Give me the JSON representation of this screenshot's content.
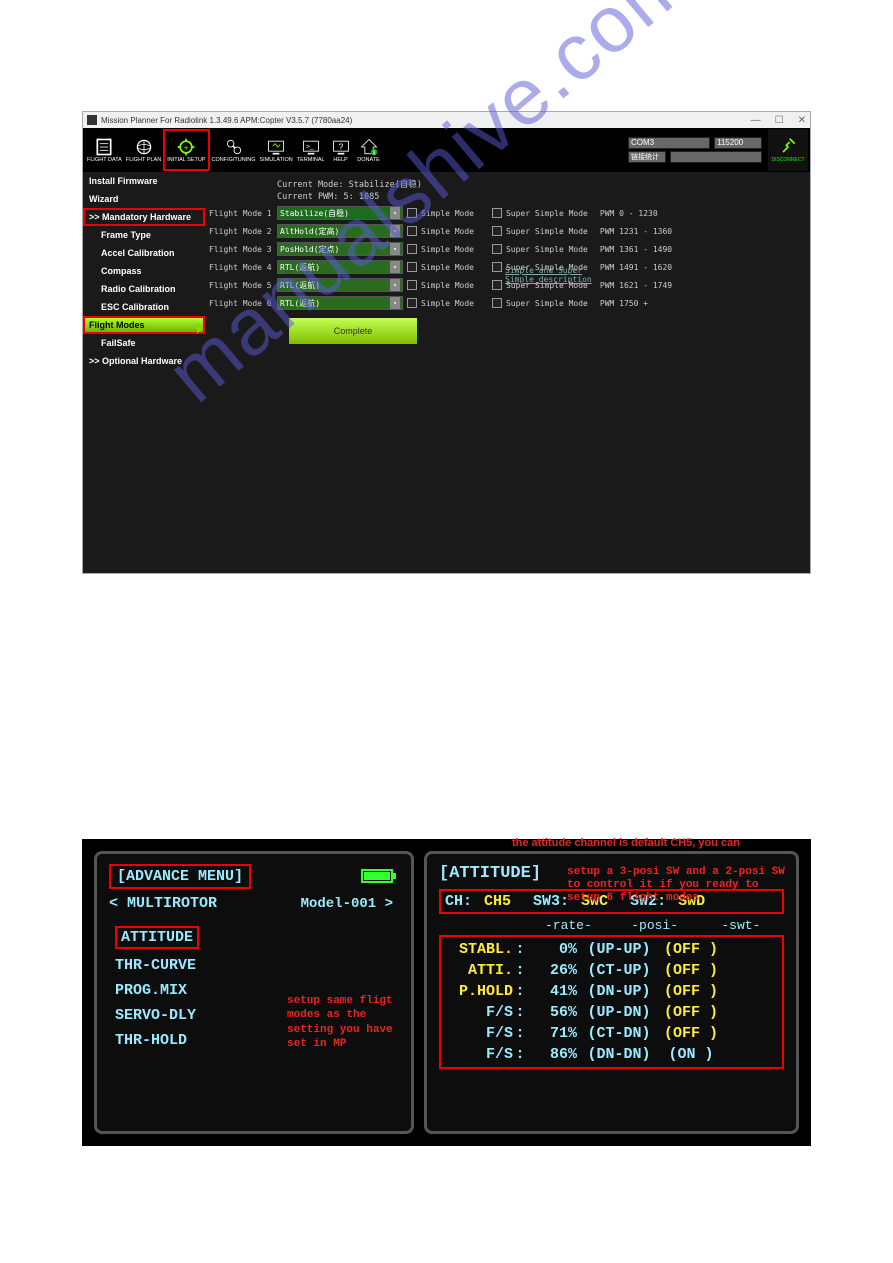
{
  "mp": {
    "title": "Mission Planner For Radiolink 1.3.49.6 APM:Copter V3.5.7 (7780aa24)",
    "toolbar": [
      "FLIGHT DATA",
      "FLIGHT PLAN",
      "INITIAL SETUP",
      "CONFIG/TUNING",
      "SIMULATION",
      "TERMINAL",
      "HELP",
      "DONATE"
    ],
    "com": {
      "port": "COM3",
      "baud": "115200",
      "stats": "链接统计"
    },
    "disconnect": "DISCONNECT",
    "side": {
      "install": "Install Firmware",
      "wizard": "Wizard",
      "mandatory": ">> Mandatory Hardware",
      "frame": "Frame Type",
      "accel": "Accel Calibration",
      "compass": "Compass",
      "radio": "Radio Calibration",
      "esc": "ESC Calibration",
      "flight": "Flight Modes",
      "failsafe": "FailSafe",
      "optional": ">> Optional Hardware"
    },
    "info1": "Current Mode: Stabilize(自稳)",
    "info2": "Current PWM:  5: 1085",
    "rows": [
      {
        "label": "Flight Mode 1",
        "sel": "Stabilize(自稳)",
        "pwm": "PWM 0 - 1230"
      },
      {
        "label": "Flight Mode 2",
        "sel": "AltHold(定高)",
        "pwm": "PWM 1231 - 1360"
      },
      {
        "label": "Flight Mode 3",
        "sel": "PosHold(定点)",
        "pwm": "PWM 1361 - 1490"
      },
      {
        "label": "Flight Mode 4",
        "sel": "RTL(返航)",
        "pwm": "PWM 1491 - 1620"
      },
      {
        "label": "Flight Mode 5",
        "sel": "RTL(返航)",
        "pwm": "PWM 1621 - 1749"
      },
      {
        "label": "Flight Mode 6",
        "sel": "RTL(返航)",
        "pwm": "PWM 1750 +"
      }
    ],
    "cb1": "Simple Mode",
    "cb2": "Super Simple Mode",
    "link1": "Simple and Super",
    "link2": "Simple description",
    "complete": "Complete"
  },
  "watermark": "manualshive.com",
  "tx": {
    "left": {
      "title": "[ADVANCE MENU]",
      "sub": "< MULTIROTOR",
      "model": "Model-001 >",
      "items": [
        "ATTITUDE",
        "THR-CURVE",
        "PROG.MIX",
        "SERVO-DLY",
        "THR-HOLD"
      ],
      "note": "setup same fligt modes as the setting you have set in MP"
    },
    "right": {
      "pretitle": "the attitude channel is default CH5, you can",
      "title": "[ATTITUDE]",
      "note": "setup a 3-posi SW and a 2-posi SW to control it if you ready to setup 6 flight modes",
      "ch_lbl": "CH:",
      "ch_val": "CH5",
      "sw3_lbl": "SW3:",
      "sw3_val": "SwC",
      "sw2_lbl": "SW2:",
      "sw2_val": "SwD",
      "hdr": [
        "-rate-",
        "-posi-",
        "-swt-"
      ],
      "rows": [
        {
          "n": "STABL.",
          "r": "0%",
          "p": "(UP-UP)",
          "s": "(OFF )",
          "y": true
        },
        {
          "n": "ATTI.",
          "r": "26%",
          "p": "(CT-UP)",
          "s": "(OFF )",
          "y": true
        },
        {
          "n": "P.HOLD",
          "r": "41%",
          "p": "(DN-UP)",
          "s": "(OFF )",
          "y": true
        },
        {
          "n": "F/S",
          "r": "56%",
          "p": "(UP-DN)",
          "s": "(OFF )",
          "y": false
        },
        {
          "n": "F/S",
          "r": "71%",
          "p": "(CT-DN)",
          "s": "(OFF )",
          "y": false
        },
        {
          "n": "F/S",
          "r": "86%",
          "p": "(DN-DN)",
          "s": "(ON  )",
          "y": false,
          "on": true
        }
      ]
    }
  }
}
